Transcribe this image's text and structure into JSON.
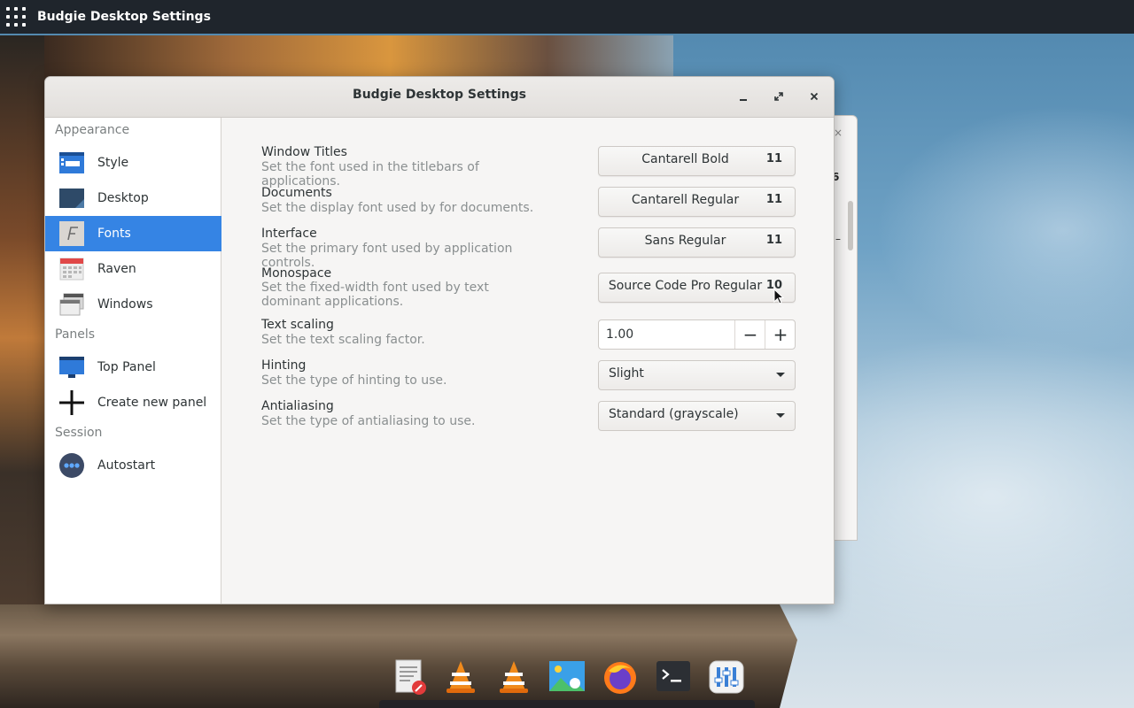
{
  "panel": {
    "title": "Budgie Desktop Settings"
  },
  "window": {
    "title": "Budgie Desktop Settings",
    "minimize_icon": "minimize-icon",
    "maximize_icon": "maximize-icon",
    "close_icon": "close-icon"
  },
  "background_window": {
    "close_glyph": "×",
    "visible_number": "6",
    "visible_dash": "–"
  },
  "sidebar": {
    "sections": [
      {
        "label": "Appearance"
      },
      {
        "label": "Panels"
      },
      {
        "label": "Session"
      }
    ],
    "items": [
      {
        "label": "Style",
        "icon": "style-icon"
      },
      {
        "label": "Desktop",
        "icon": "desktop-icon"
      },
      {
        "label": "Fonts",
        "icon": "fonts-icon",
        "active": true
      },
      {
        "label": "Raven",
        "icon": "calendar-icon"
      },
      {
        "label": "Windows",
        "icon": "windows-icon"
      },
      {
        "label": "Top Panel",
        "icon": "panel-icon"
      },
      {
        "label": "Create new panel",
        "icon": "plus-icon"
      },
      {
        "label": "Autostart",
        "icon": "autostart-icon"
      }
    ]
  },
  "fonts": {
    "window_titles": {
      "title": "Window Titles",
      "description": "Set the font used in the titlebars of applications.",
      "font": "Cantarell Bold",
      "size": "11"
    },
    "documents": {
      "title": "Documents",
      "description": "Set the display font used by for documents.",
      "font": "Cantarell Regular",
      "size": "11"
    },
    "interface": {
      "title": "Interface",
      "description": "Set the primary font used by application controls.",
      "font": "Sans Regular",
      "size": "11"
    },
    "monospace": {
      "title": "Monospace",
      "description": "Set the fixed-width font used by text dominant applications.",
      "font": "Source Code Pro Regular",
      "size": "10"
    },
    "text_scaling": {
      "title": "Text scaling",
      "description": "Set the text scaling factor.",
      "value": "1.00",
      "decrement": "−",
      "increment": "+"
    },
    "hinting": {
      "title": "Hinting",
      "description": "Set the type of hinting to use.",
      "value": "Slight"
    },
    "antialiasing": {
      "title": "Antialiasing",
      "description": "Set the type of antialiasing to use.",
      "value": "Standard (grayscale)"
    }
  },
  "dock": {
    "items": [
      {
        "icon": "text-editor-icon"
      },
      {
        "icon": "vlc-icon"
      },
      {
        "icon": "vlc-icon"
      },
      {
        "icon": "image-viewer-icon"
      },
      {
        "icon": "firefox-icon"
      },
      {
        "icon": "terminal-icon"
      },
      {
        "icon": "settings-mixer-icon"
      }
    ]
  },
  "colors": {
    "accent": "#3584e4",
    "panel_bg": "#1f252c",
    "window_bg": "#f6f5f4"
  }
}
